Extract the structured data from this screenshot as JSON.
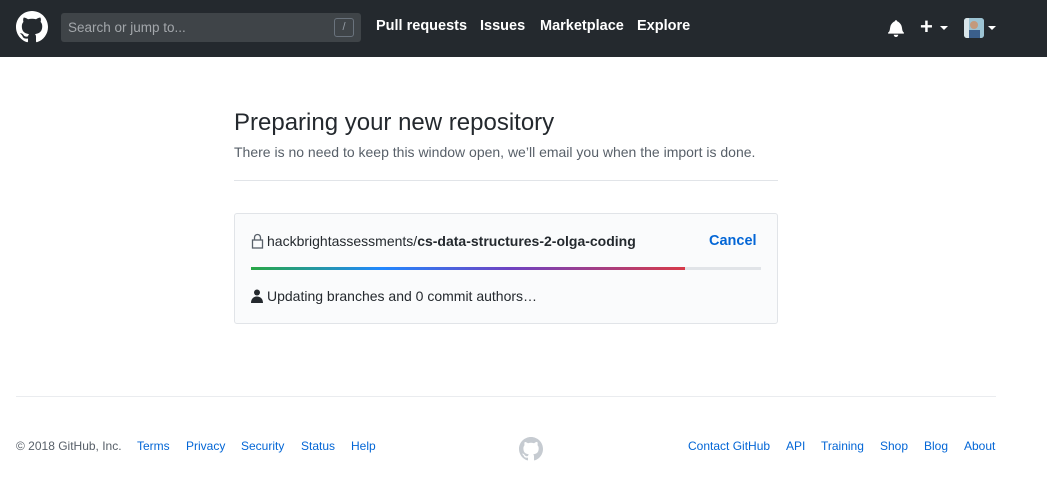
{
  "header": {
    "search_placeholder": "Search or jump to...",
    "search_shortcut": "/",
    "nav": [
      "Pull requests",
      "Issues",
      "Marketplace",
      "Explore"
    ],
    "new_label": "+",
    "icons": [
      "github-logo-icon",
      "bell-icon",
      "plus-icon",
      "chevron-down-icon",
      "avatar"
    ]
  },
  "main": {
    "title": "Preparing your new repository",
    "subtitle": "There is no need to keep this window open, we’ll email you when the import is done.",
    "repo_owner": "hackbrightassessments/",
    "repo_name": "cs-data-structures-2-olga-coding",
    "cancel_label": "Cancel",
    "progress": 0.85,
    "status": "Updating branches and 0 commit authors…"
  },
  "footer": {
    "copyright": "© 2018 GitHub, Inc.",
    "left_links": [
      "Terms",
      "Privacy",
      "Security",
      "Status",
      "Help"
    ],
    "right_links": [
      "Contact GitHub",
      "API",
      "Training",
      "Shop",
      "Blog",
      "About"
    ]
  },
  "colors": {
    "header_bg": "#24292e",
    "link": "#0366d6",
    "progress_gradient": [
      "#28a745",
      "#2188ff",
      "#6f42c1",
      "#d73a49"
    ]
  }
}
